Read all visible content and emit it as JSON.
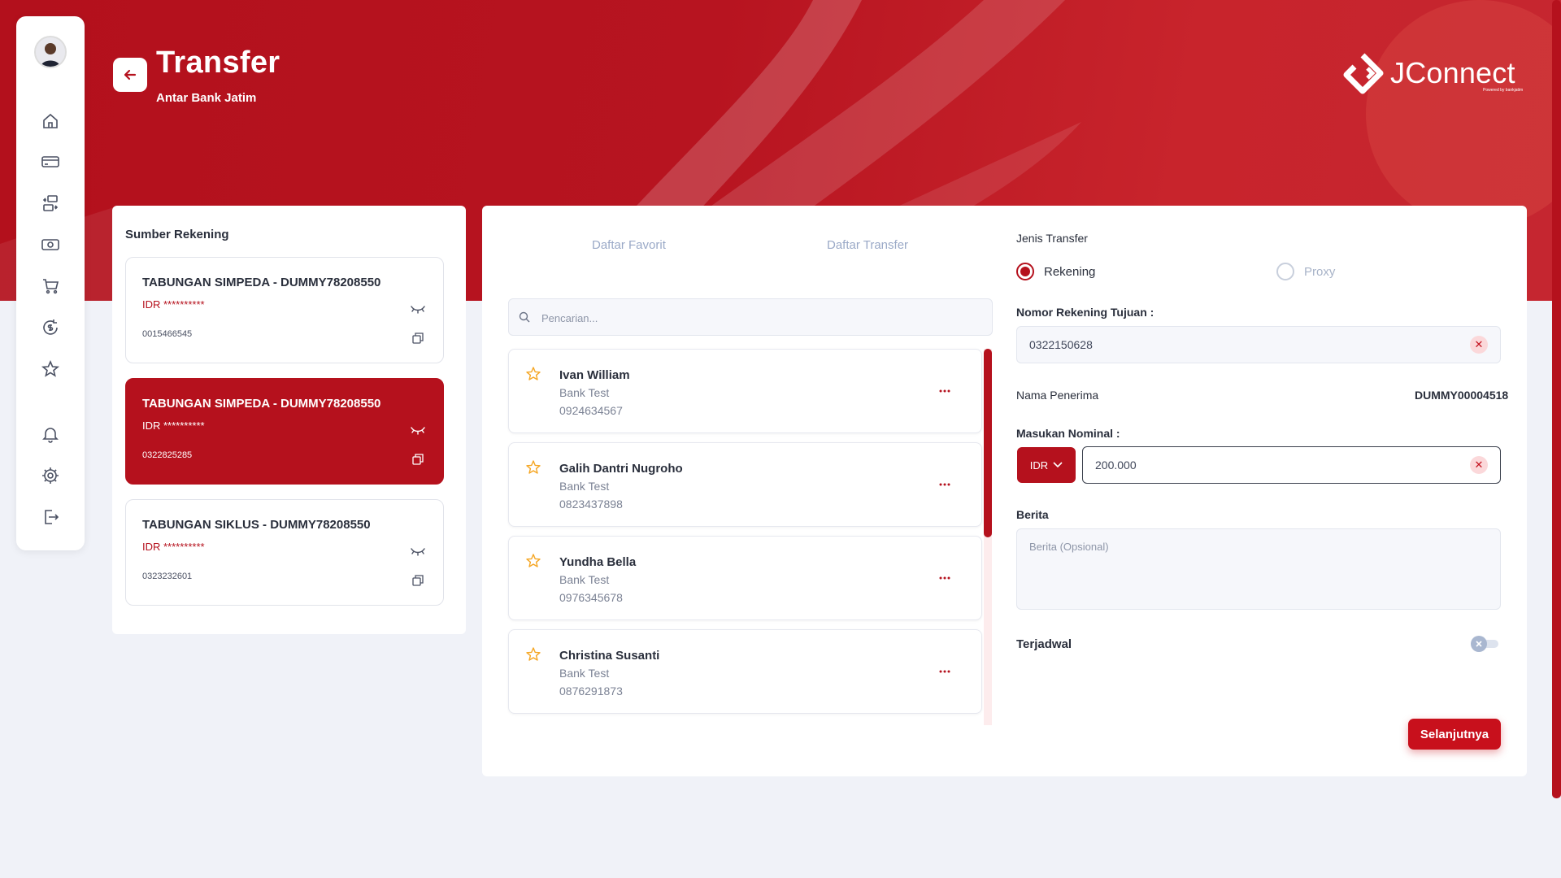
{
  "header": {
    "title": "Transfer",
    "subtitle": "Antar Bank Jatim",
    "logo_text": "JConnect",
    "logo_powered": "Powered by bankjatim"
  },
  "colors": {
    "primary": "#b5111d",
    "button": "#c8101c",
    "background": "#f0f2f8"
  },
  "sidebar": {
    "items": [
      {
        "icon": "home-icon"
      },
      {
        "icon": "credit-card-icon"
      },
      {
        "icon": "exchange-icon"
      },
      {
        "icon": "cash-icon"
      },
      {
        "icon": "cart-icon"
      },
      {
        "icon": "dollar-refresh-icon"
      },
      {
        "icon": "star-icon"
      },
      {
        "icon": "bell-icon"
      },
      {
        "icon": "gear-icon"
      },
      {
        "icon": "logout-icon"
      }
    ]
  },
  "source": {
    "title": "Sumber Rekening",
    "accounts": [
      {
        "name": "TABUNGAN SIMPEDA - DUMMY78208550",
        "balance": "IDR **********",
        "number": "0015466545",
        "active": false
      },
      {
        "name": "TABUNGAN SIMPEDA - DUMMY78208550",
        "balance": "IDR **********",
        "number": "0322825285",
        "active": true
      },
      {
        "name": "TABUNGAN SIKLUS - DUMMY78208550",
        "balance": "IDR **********",
        "number": "0323232601",
        "active": false
      }
    ]
  },
  "tabs": {
    "favorites": "Daftar Favorit",
    "transfers": "Daftar Transfer"
  },
  "search": {
    "placeholder": "Pencarian..."
  },
  "contacts": [
    {
      "name": "Ivan William",
      "bank": "Bank Test",
      "number": "0924634567"
    },
    {
      "name": "Galih Dantri Nugroho",
      "bank": "Bank Test",
      "number": "0823437898"
    },
    {
      "name": "Yundha Bella",
      "bank": "Bank Test",
      "number": "0976345678"
    },
    {
      "name": "Christina Susanti",
      "bank": "Bank Test",
      "number": "0876291873"
    }
  ],
  "form": {
    "type_label": "Jenis Transfer",
    "option_account": "Rekening",
    "option_proxy": "Proxy",
    "dest_label": "Nomor Rekening Tujuan :",
    "dest_value": "0322150628",
    "recipient_label": "Nama Penerima",
    "recipient_value": "DUMMY00004518",
    "amount_label": "Masukan Nominal :",
    "currency": "IDR",
    "amount_value": "200.000",
    "note_label": "Berita",
    "note_placeholder": "Berita (Opsional)",
    "scheduled_label": "Terjadwal",
    "next_button": "Selanjutnya"
  }
}
